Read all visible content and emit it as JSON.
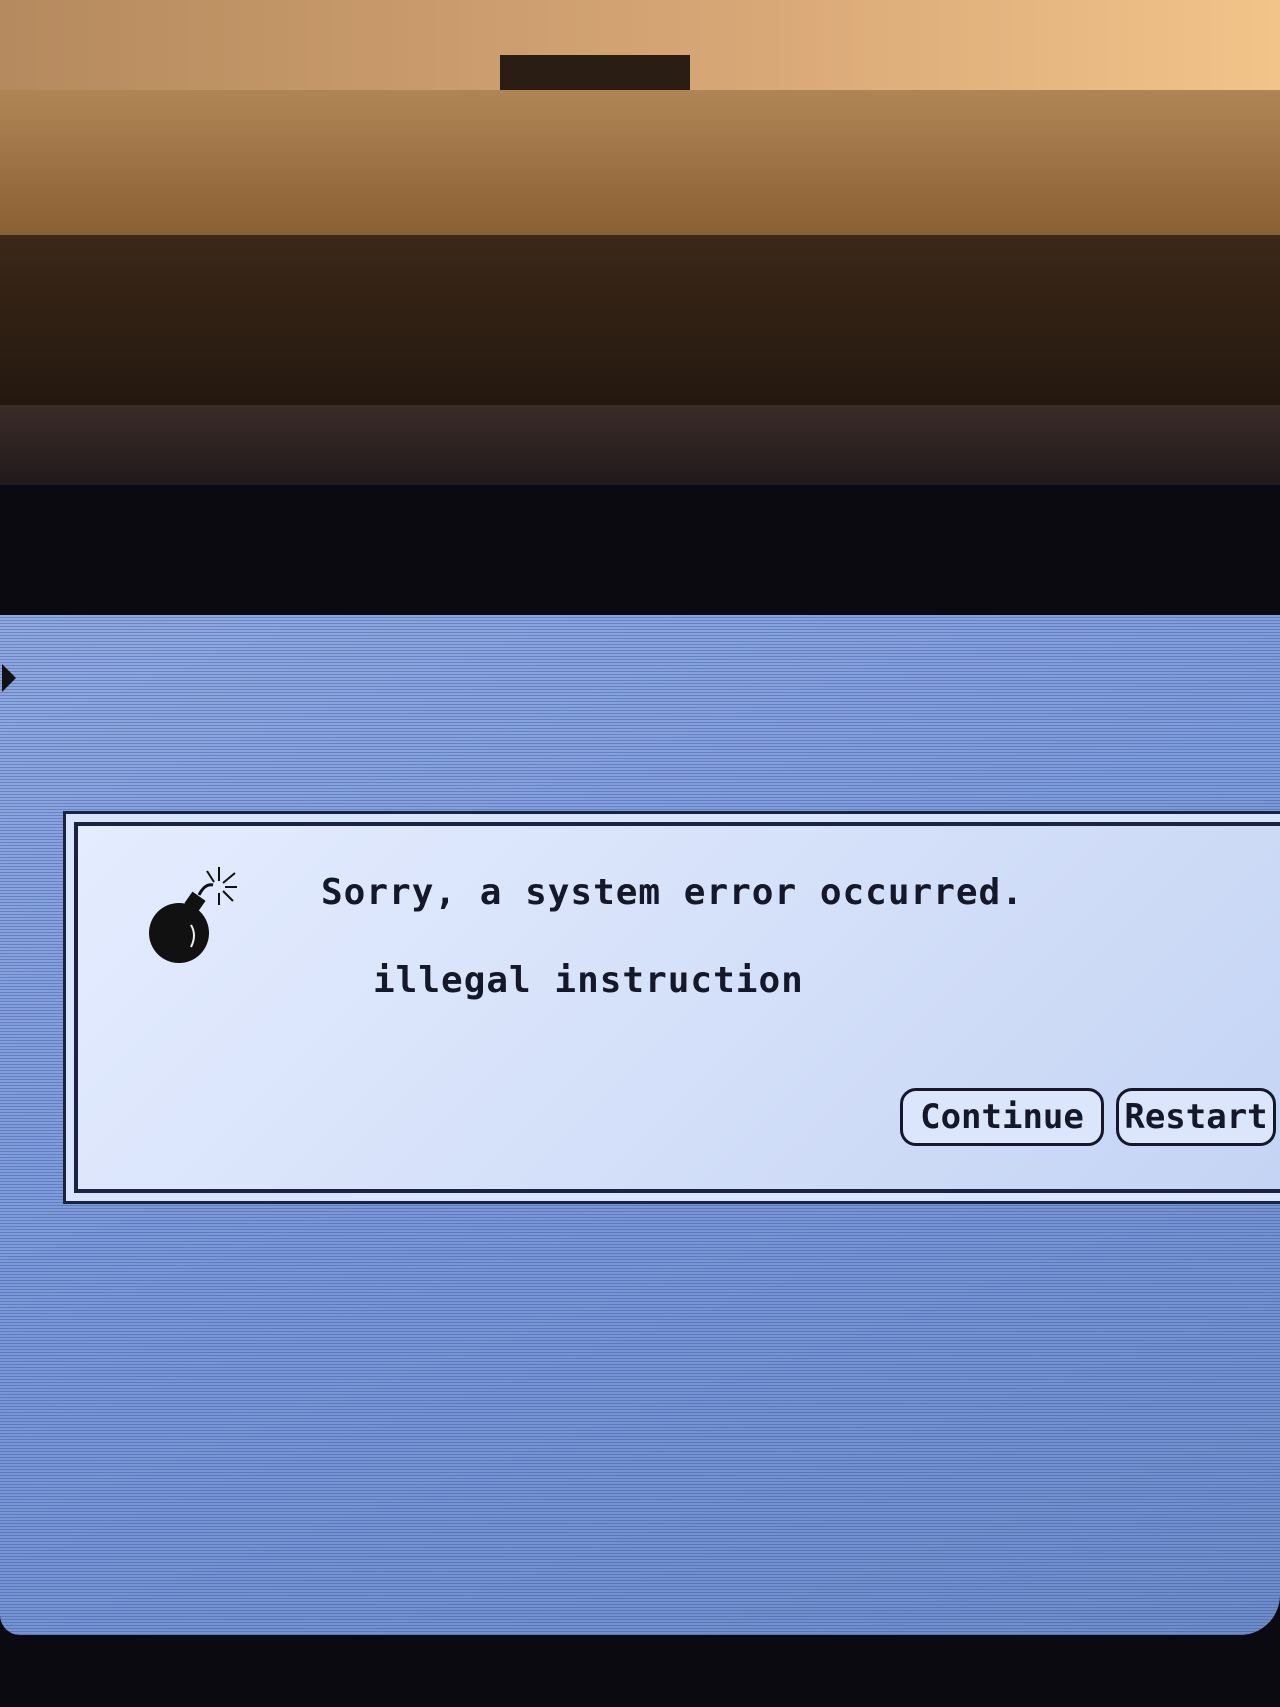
{
  "dialog": {
    "title": "Sorry, a system error occurred.",
    "message": "illegal instruction",
    "icon": "bomb-icon",
    "buttons": {
      "continue_label": "Continue",
      "restart_label": "Restart"
    }
  },
  "colors": {
    "screen": "#7a98d8",
    "dialog": "#d8e4fb",
    "ink": "#14182a"
  }
}
